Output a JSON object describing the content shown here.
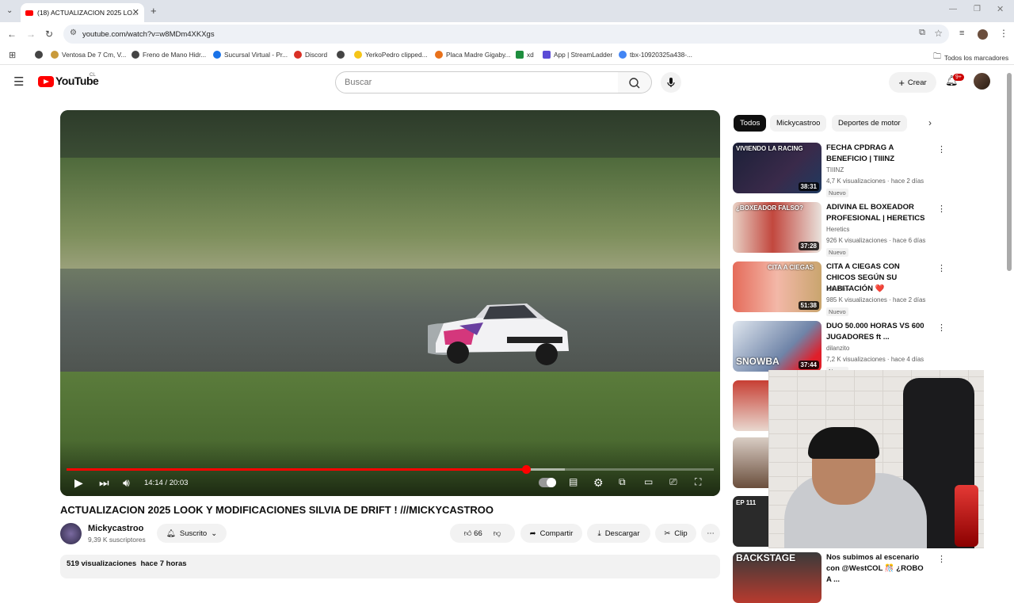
{
  "browser": {
    "tab_title": "(18) ACTUALIZACION 2025 LO...",
    "url": "youtube.com/watch?v=w8MDm4XKXgs",
    "bookmarks": [
      {
        "label": "Ventosa De 7 Cm, V...",
        "color": "#c99a3a"
      },
      {
        "label": "Freno de Mano Hidr...",
        "color": "#444444"
      },
      {
        "label": "Sucursal Virtual - Pr...",
        "color": "#1a73e8"
      },
      {
        "label": "Discord",
        "color": "#d93025"
      },
      {
        "label": "YerkoPedro clipped...",
        "color": "#f5c518"
      },
      {
        "label": "Placa Madre Gigaby...",
        "color": "#e8711a"
      },
      {
        "label": "xd",
        "color": "#1e8e3e"
      },
      {
        "label": "App | StreamLadder",
        "color": "#5b4bd6"
      },
      {
        "label": "tbx-10920325a438-...",
        "color": "#4285f4"
      }
    ],
    "all_bookmarks": "Todos los marcadores"
  },
  "header": {
    "logo": "YouTube",
    "country": "CL",
    "search_placeholder": "Buscar",
    "create_label": "Crear",
    "notif_count": "9+"
  },
  "player": {
    "time": "14:14 / 20:03",
    "progress": 0.71,
    "buffered": 0.77
  },
  "video": {
    "title": "ACTUALIZACION 2025 LOOK Y MODIFICACIONES SILVIA DE DRIFT ! ///MICKYCASTROO",
    "channel": "Mickycastroo",
    "subscribers": "9,39 K suscriptores",
    "subscribed_label": "Suscrito",
    "likes": "66",
    "share_label": "Compartir",
    "download_label": "Descargar",
    "clip_label": "Clip",
    "stats": "519 visualizaciones  hace 7 horas"
  },
  "chips": [
    "Todos",
    "Mickycastroo",
    "Deportes de motor"
  ],
  "recommendations": [
    {
      "title": "FECHA CPDRAG A BENEFICIO | TIIINZ",
      "channel": "TIIINZ",
      "meta": "4,7 K visualizaciones · hace 2 días",
      "badge": "Nuevo",
      "duration": "38:31",
      "thumb_text": "VIVIENDO LA RACING",
      "color": "#1b2038"
    },
    {
      "title": "ADIVINA EL BOXEADOR PROFESIONAL | HERETICS",
      "channel": "Heretics",
      "meta": "926 K visualizaciones · hace 6 días",
      "badge": "Nuevo",
      "duration": "37:28",
      "thumb_text": "¿BOXEADOR FALSO?",
      "color": "#c2473e"
    },
    {
      "title": "CITA A CIEGAS CON CHICOS SEGÚN SU HABITACIÓN ❤️",
      "channel": "lebriah",
      "meta": "985 K visualizaciones · hace 2 días",
      "badge": "Nuevo",
      "duration": "51:38",
      "thumb_text": "CITA A CIEGAS",
      "color": "#e56b5a"
    },
    {
      "title": "DUO 50.000 HORAS VS 600 JUGADORES ft ...",
      "channel": "dilanzito",
      "meta": "7,2 K visualizaciones · hace 4 días",
      "badge": "Nuevo",
      "duration": "37:44",
      "thumb_text": "SNOWBA",
      "color": "#6f84a8"
    },
    {
      "title": "Nos subimos al escenario con @WestCOL 🎊 ¿ROBO A ...",
      "channel": "",
      "meta": "",
      "badge": "",
      "duration": "",
      "thumb_text": "BACKSTAGE",
      "color": "#3a3a3a"
    }
  ]
}
